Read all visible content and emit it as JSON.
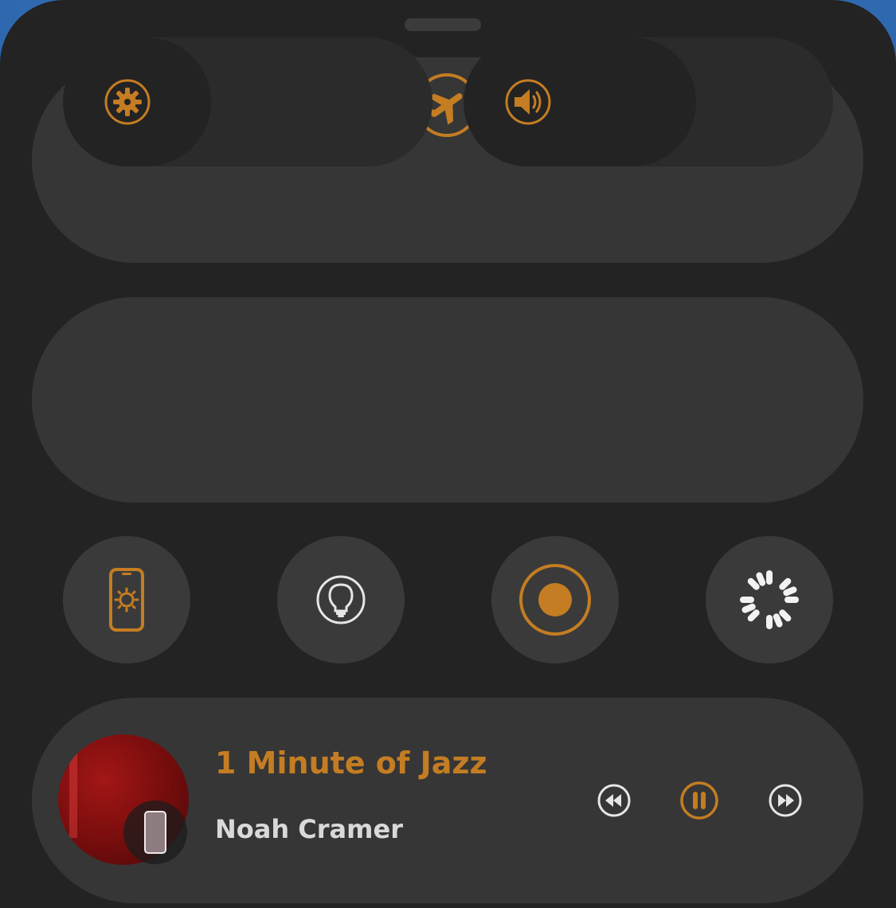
{
  "colors": {
    "accent": "#c47d22",
    "panel": "#232323",
    "tile": "#363636",
    "inactive_icon": "#e6e6e6"
  },
  "toggles": [
    {
      "icon": "wifi-icon",
      "state": "on"
    },
    {
      "icon": "bluetooth-icon",
      "state": "on"
    },
    {
      "icon": "airplane-icon",
      "state": "on"
    },
    {
      "icon": "nfc-phone-icon",
      "state": "off"
    },
    {
      "icon": "parachute-icon",
      "state": "on"
    }
  ],
  "sliders": {
    "brightness": {
      "icon": "brightness-gear-icon",
      "level": 0.4
    },
    "volume": {
      "icon": "speaker-icon",
      "level": 0.63
    }
  },
  "quick_actions": [
    {
      "icon": "phone-brightness-icon",
      "state": "on"
    },
    {
      "icon": "flashlight-icon",
      "state": "off"
    },
    {
      "icon": "record-icon",
      "state": "on"
    },
    {
      "icon": "loading-spinner-icon",
      "state": "off"
    }
  ],
  "media": {
    "title": "1 Minute of Jazz",
    "artist": "Noah Cramer",
    "state": "playing",
    "controls": [
      "previous-icon",
      "pause-icon",
      "next-icon"
    ]
  }
}
